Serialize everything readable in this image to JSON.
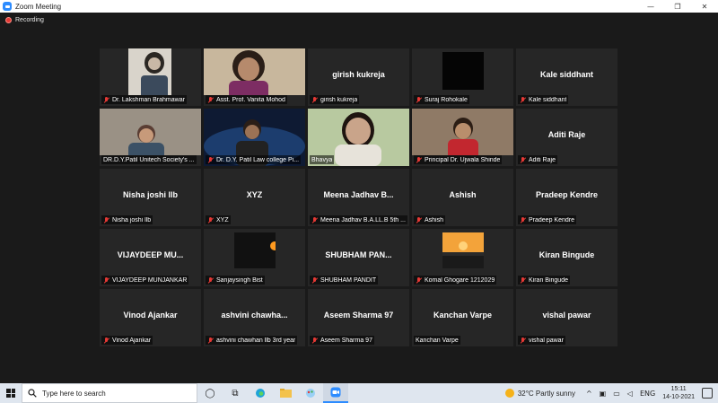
{
  "window": {
    "title": "Zoom Meeting",
    "controls": [
      "—",
      "❐",
      "✕"
    ]
  },
  "recording": {
    "label": "Recording"
  },
  "participants": [
    {
      "name": "Dr. Lakshman Brahmawar",
      "display": "",
      "video": true,
      "muted": true
    },
    {
      "name": "Asst. Prof. Vanita Mohod",
      "display": "",
      "video": true,
      "muted": true
    },
    {
      "name": "girish kukreja",
      "display": "girish kukreja",
      "video": false,
      "muted": true
    },
    {
      "name": "Suraj Rohokale",
      "display": "",
      "video": true,
      "muted": true
    },
    {
      "name": "Kale siddhant",
      "display": "Kale siddhant",
      "video": false,
      "muted": true
    },
    {
      "name": "DR.D.Y.Patil Unitech Society's ...",
      "display": "",
      "video": true,
      "muted": false
    },
    {
      "name": "Dr. D.Y. Patil Law college Pi...",
      "display": "",
      "video": true,
      "muted": true
    },
    {
      "name": "Bhavya",
      "display": "",
      "video": true,
      "muted": false,
      "active": true
    },
    {
      "name": "Principal Dr. Ujwala Shinde",
      "display": "",
      "video": true,
      "muted": true
    },
    {
      "name": "Aditi Raje",
      "display": "Aditi Raje",
      "video": false,
      "muted": true
    },
    {
      "name": "Nisha joshi llb",
      "display": "Nisha joshi llb",
      "video": false,
      "muted": true
    },
    {
      "name": "XYZ",
      "display": "XYZ",
      "video": false,
      "muted": true
    },
    {
      "name": "Meena Jadhav B.A.LL.B 5th ...",
      "display": "Meena Jadhav  B...",
      "video": false,
      "muted": true
    },
    {
      "name": "Ashish",
      "display": "Ashish",
      "video": false,
      "muted": true
    },
    {
      "name": "Pradeep Kendre",
      "display": "Pradeep Kendre",
      "video": false,
      "muted": true
    },
    {
      "name": "VIJAYDEEP MUNJANKAR",
      "display": "VIJAYDEEP  MU...",
      "video": false,
      "muted": true
    },
    {
      "name": "Sanjaysingh Bist",
      "display": "",
      "video": true,
      "muted": true
    },
    {
      "name": "SHUBHAM PANDIT",
      "display": "SHUBHAM  PAN...",
      "video": false,
      "muted": true
    },
    {
      "name": "Komal Ghogare 1212029",
      "display": "",
      "video": true,
      "muted": true
    },
    {
      "name": "Kiran Bingude",
      "display": "Kiran Bingude",
      "video": false,
      "muted": true
    },
    {
      "name": "Vinod Ajankar",
      "display": "Vinod Ajankar",
      "video": false,
      "muted": true
    },
    {
      "name": "ashvini chawhan llb 3rd year",
      "display": "ashvini  chawha...",
      "video": false,
      "muted": true
    },
    {
      "name": "Aseem Sharma 97",
      "display": "Aseem Sharma 97",
      "video": false,
      "muted": true
    },
    {
      "name": "Kanchan Varpe",
      "display": "Kanchan Varpe",
      "video": false,
      "muted": false
    },
    {
      "name": "vishal pawar",
      "display": "vishal pawar",
      "video": false,
      "muted": true
    }
  ],
  "taskbar": {
    "search_placeholder": "Type here to search",
    "weather_temp": "32°C",
    "weather_text": "Partly sunny",
    "language": "ENG",
    "time": "15:11",
    "date": "14-10-2021"
  },
  "colors": {
    "accent": "#2d8cff",
    "active_speaker": "#e8e36a",
    "muted": "#e53935"
  }
}
